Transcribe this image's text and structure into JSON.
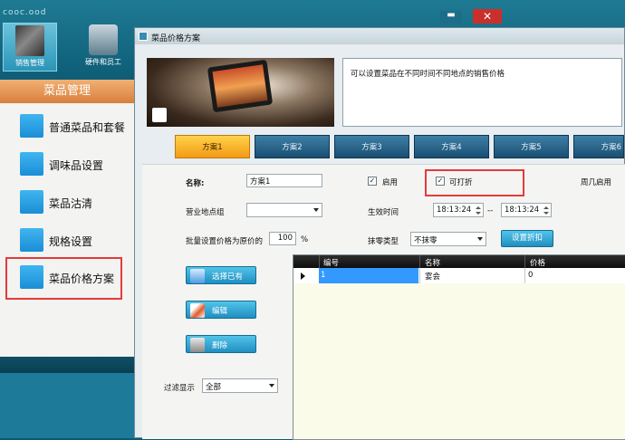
{
  "app": {
    "logo": "cooc.ood",
    "top_buttons": [
      {
        "label": "销售管理"
      },
      {
        "label": "硬件和员工"
      }
    ],
    "window_controls": {
      "minimize": "▬",
      "close": "✕"
    }
  },
  "sidebar": {
    "header": "菜品管理",
    "items": [
      {
        "label": "普通菜品和套餐"
      },
      {
        "label": "调味品设置"
      },
      {
        "label": "菜品沽清"
      },
      {
        "label": "规格设置"
      },
      {
        "label": "菜品价格方案"
      }
    ],
    "selected_index": 4
  },
  "dialog": {
    "title": "菜品价格方案",
    "description": "可以设置菜品在不同时间不同地点的销售价格",
    "tabs": [
      {
        "label": "方案1",
        "active": true
      },
      {
        "label": "方案2"
      },
      {
        "label": "方案3"
      },
      {
        "label": "方案4"
      },
      {
        "label": "方案5"
      },
      {
        "label": "方案6"
      }
    ],
    "form": {
      "name_label": "名称:",
      "name_value": "方案1",
      "enable_label": "启用",
      "enable_checked": true,
      "discount_label": "可打折",
      "discount_checked": true,
      "weekday_label": "周几启用",
      "location_group_label": "营业地点组",
      "location_group_value": "",
      "effective_time_label": "生效时间",
      "time_start": "18:13:24",
      "time_sep": "--",
      "time_end": "18:13:24",
      "batch_label": "批量设置价格为原价的",
      "batch_value": "100",
      "batch_unit": "%",
      "rounding_label": "抹零类型",
      "rounding_value": "不抹零",
      "set_discount_button": "设置折扣"
    },
    "actions": {
      "select_existing": "选择已有",
      "edit": "编辑",
      "delete": "删除"
    },
    "filter": {
      "label": "过滤显示",
      "value": "全部"
    },
    "table": {
      "columns": [
        "编号",
        "名称",
        "价格"
      ],
      "rows": [
        {
          "id": "1",
          "name": "宴会",
          "price": "0"
        }
      ]
    }
  }
}
